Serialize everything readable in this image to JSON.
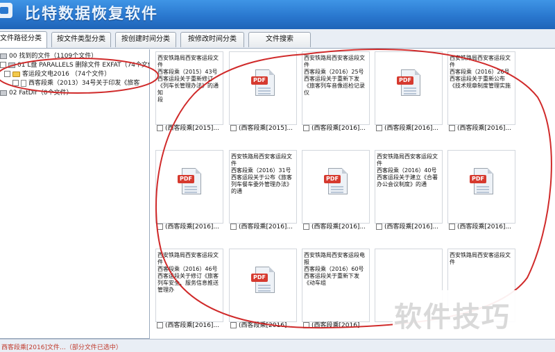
{
  "app": {
    "title": "比特数据恢复软件"
  },
  "tabs": [
    {
      "label": "文件路径分类",
      "active": true
    },
    {
      "label": "按文件类型分类",
      "active": false
    },
    {
      "label": "按创建时间分类",
      "active": false
    },
    {
      "label": "按修改时间分类",
      "active": false
    },
    {
      "label": "文件搜索",
      "active": false
    }
  ],
  "tree": {
    "items": [
      {
        "label": "00 找到的文件（1109个文件）",
        "icon": "drive-icon"
      },
      {
        "label": "01 L盘 PARALLELS 删除文件 EXFAT（74个文件）",
        "icon": "drive-icon"
      },
      {
        "label": "客运段文电2016  （74个文件）",
        "icon": "folder-icon"
      },
      {
        "label": "西客段乘（2013）34号关于印发《旅客",
        "icon": "file-icon"
      },
      {
        "label": "02 FatDir（0个文件）",
        "icon": "drive-icon"
      }
    ]
  },
  "grid": {
    "tiles": [
      {
        "type": "text",
        "lines": [
          "西安铁路局西安客运段文件",
          "西客段乘（2015）43号",
          "西客运段关于重新修订《列车长管理办法》的通知",
          "段"
        ],
        "caption": "(西客段乘[2015]..."
      },
      {
        "type": "pdf",
        "icon_label": "PDF",
        "caption": "(西客段乘[2015]..."
      },
      {
        "type": "text",
        "lines": [
          "西安铁路局西安客运段文件",
          "西客段乘（2016）25号",
          "西客运段关于重新下发《旅客列车音像巡检记录仪"
        ],
        "caption": "(西客段乘[2016]..."
      },
      {
        "type": "pdf",
        "icon_label": "PDF",
        "caption": "(西客段乘[2016]..."
      },
      {
        "type": "text",
        "lines": [
          "西安铁路局西安客运段文件",
          "西客段乘（2016）26号",
          "西客运段关于重新公布《技术规章制度管理实施"
        ],
        "caption": "(西客段乘[2016]..."
      },
      {
        "type": "pdf",
        "icon_label": "PDF",
        "caption": "(西客段乘[2016]..."
      },
      {
        "type": "text",
        "lines": [
          "西安铁路局西安客运段文件",
          "西客段乘（2016）31号",
          "西客运段关于公布《旅客列车餐车委外管理办法》的通"
        ],
        "caption": "(西客段乘[2016]..."
      },
      {
        "type": "pdf",
        "icon_label": "PDF",
        "caption": "(西客段乘[2016]..."
      },
      {
        "type": "text",
        "lines": [
          "西安铁路局西安客运段文件",
          "西客段乘（2016）40号",
          "西客运段关于建立《合署办公会议制度》的通"
        ],
        "caption": "(西客段乘[2016]..."
      },
      {
        "type": "pdf",
        "icon_label": "PDF",
        "caption": "(西客段乘[2016]..."
      },
      {
        "type": "text",
        "lines": [
          "西安铁路局西安客运段文件",
          "西客段乘（2016）46号",
          "西客运段关于修订《旅客列车安全、服务信息推送管理办"
        ],
        "caption": "(西客段乘[2016]..."
      },
      {
        "type": "pdf",
        "icon_label": "PDF",
        "caption": "(西客段乘[2016]..."
      },
      {
        "type": "text",
        "lines": [
          "西安铁路局西安客运段电报",
          "西客段乘（2016）60号",
          "西客运段关于重新下发《动车组"
        ],
        "caption": "(西客段乘[2016]..."
      },
      {
        "type": "blank",
        "caption": ""
      },
      {
        "type": "text",
        "lines": [
          "西安铁路局西安客运段文件"
        ],
        "caption": ""
      }
    ]
  },
  "status": {
    "text": "西客段乘[2016]文件…（部分文件已选中）"
  },
  "watermark": {
    "text": "软件技巧"
  },
  "colors": {
    "header": "#2a78cf",
    "annotation": "#d02a2a",
    "pdf_badge": "#d63a2f"
  }
}
